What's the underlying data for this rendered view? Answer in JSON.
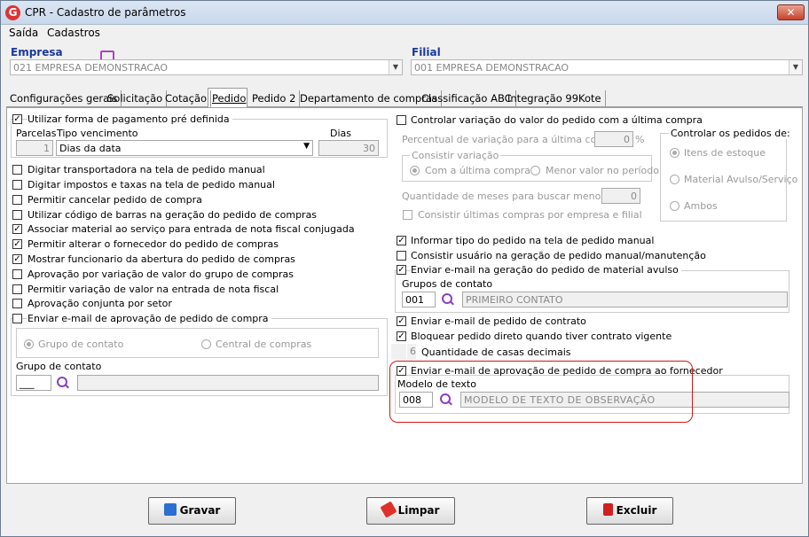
{
  "window": {
    "title": "CPR - Cadastro de parâmetros",
    "close": "✕",
    "app_icon": "G"
  },
  "menu": [
    "Saída",
    "Cadastros"
  ],
  "empresa": {
    "label": "Empresa",
    "value": "021 EMPRESA DEMONSTRACAO"
  },
  "filial": {
    "label": "Filial",
    "value": "001 EMPRESA DEMONSTRACAO"
  },
  "tabs": [
    "Configurações gerais",
    "Solicitação",
    "Cotação",
    "Pedido",
    "Pedido 2",
    "Departamento de compras",
    "Classificação ABC",
    "Integração 99Kote"
  ],
  "active_tab": "Pedido",
  "left": {
    "forma_pagamento": {
      "label": "Utilizar forma de pagamento pré definida",
      "checked": true
    },
    "parcelas_label": "Parcelas",
    "tipo_venc_label": "Tipo vencimento",
    "dias_label": "Dias",
    "parcelas_value": "1",
    "tipo_venc_value": "Dias da data",
    "dias_value": "30",
    "checks": [
      {
        "label": "Digitar transportadora na tela de pedido manual",
        "checked": false
      },
      {
        "label": "Digitar impostos e taxas na tela de pedido manual",
        "checked": false
      },
      {
        "label": "Permitir cancelar pedido de compra",
        "checked": false
      },
      {
        "label": "Utilizar código de barras na geração do pedido de compras",
        "checked": false
      },
      {
        "label": "Associar material ao serviço para entrada de nota fiscal conjugada",
        "checked": true
      },
      {
        "label": "Permitir alterar o fornecedor do pedido de compras",
        "checked": true
      },
      {
        "label": "Mostrar funcionario da abertura do pedido de compras",
        "checked": true
      },
      {
        "label": "Aprovação por variação de valor do grupo de compras",
        "checked": false
      },
      {
        "label": "Permitir variação de valor na entrada de nota fiscal",
        "checked": false
      },
      {
        "label": "Aprovação conjunta por setor",
        "checked": false
      }
    ],
    "email_aprov": {
      "label": "Enviar e-mail de aprovação de pedido de compra",
      "checked": false
    },
    "radio_grupo": "Grupo de contato",
    "radio_central": "Central de compras",
    "grupo_contato_label": "Grupo de contato",
    "grupo_contato_code": "___"
  },
  "right": {
    "controlar_var": {
      "label": "Controlar variação do valor do pedido com a última compra",
      "checked": false
    },
    "perc_label": "Percentual de variação para a última compra",
    "perc_value": "0",
    "perc_unit": "%",
    "consistir_title": "Consistir variação",
    "radio_ultima": "Com a última compra",
    "radio_menor": "Menor valor no período",
    "qtd_meses_label": "Quantidade de meses para buscar menor valor",
    "qtd_meses_value": "0",
    "consistir_ultimas": "Consistir últimas compras por empresa e filial",
    "controlar_pedidos_title": "Controlar os pedidos de:",
    "radio_itens": "Itens de estoque",
    "radio_material": "Material Avulso/Serviço",
    "radio_ambos": "Ambos",
    "informar_tipo": {
      "label": "Informar tipo do pedido na tela de pedido manual",
      "checked": true
    },
    "consistir_usuario": {
      "label": "Consistir usuário na geração de pedido manual/manutenção",
      "checked": false
    },
    "email_avulso": {
      "label": "Enviar e-mail na geração do pedido de material avulso",
      "checked": true
    },
    "grupos_contato_label": "Grupos de contato",
    "grupos_contato_code": "001",
    "grupos_contato_name": "PRIMEIRO CONTATO",
    "email_contrato": {
      "label": "Enviar e-mail de pedido de contrato",
      "checked": true
    },
    "bloquear": {
      "label": "Bloquear pedido direto quando tiver contrato vigente",
      "checked": true
    },
    "casas_value": "6",
    "casas_label": "Quantidade de casas decimais",
    "email_fornecedor": {
      "label": "Enviar e-mail de aprovação de pedido de compra ao fornecedor",
      "checked": true
    },
    "modelo_label": "Modelo de texto",
    "modelo_code": "008",
    "modelo_name": "MODELO DE TEXTO DE OBSERVAÇÃO"
  },
  "buttons": {
    "gravar": "Gravar",
    "limpar": "Limpar",
    "excluir": "Excluir"
  },
  "colors": {
    "highlight": "#d01818",
    "accent": "#1a3a9a",
    "search_icon": "#8a3fc0"
  }
}
